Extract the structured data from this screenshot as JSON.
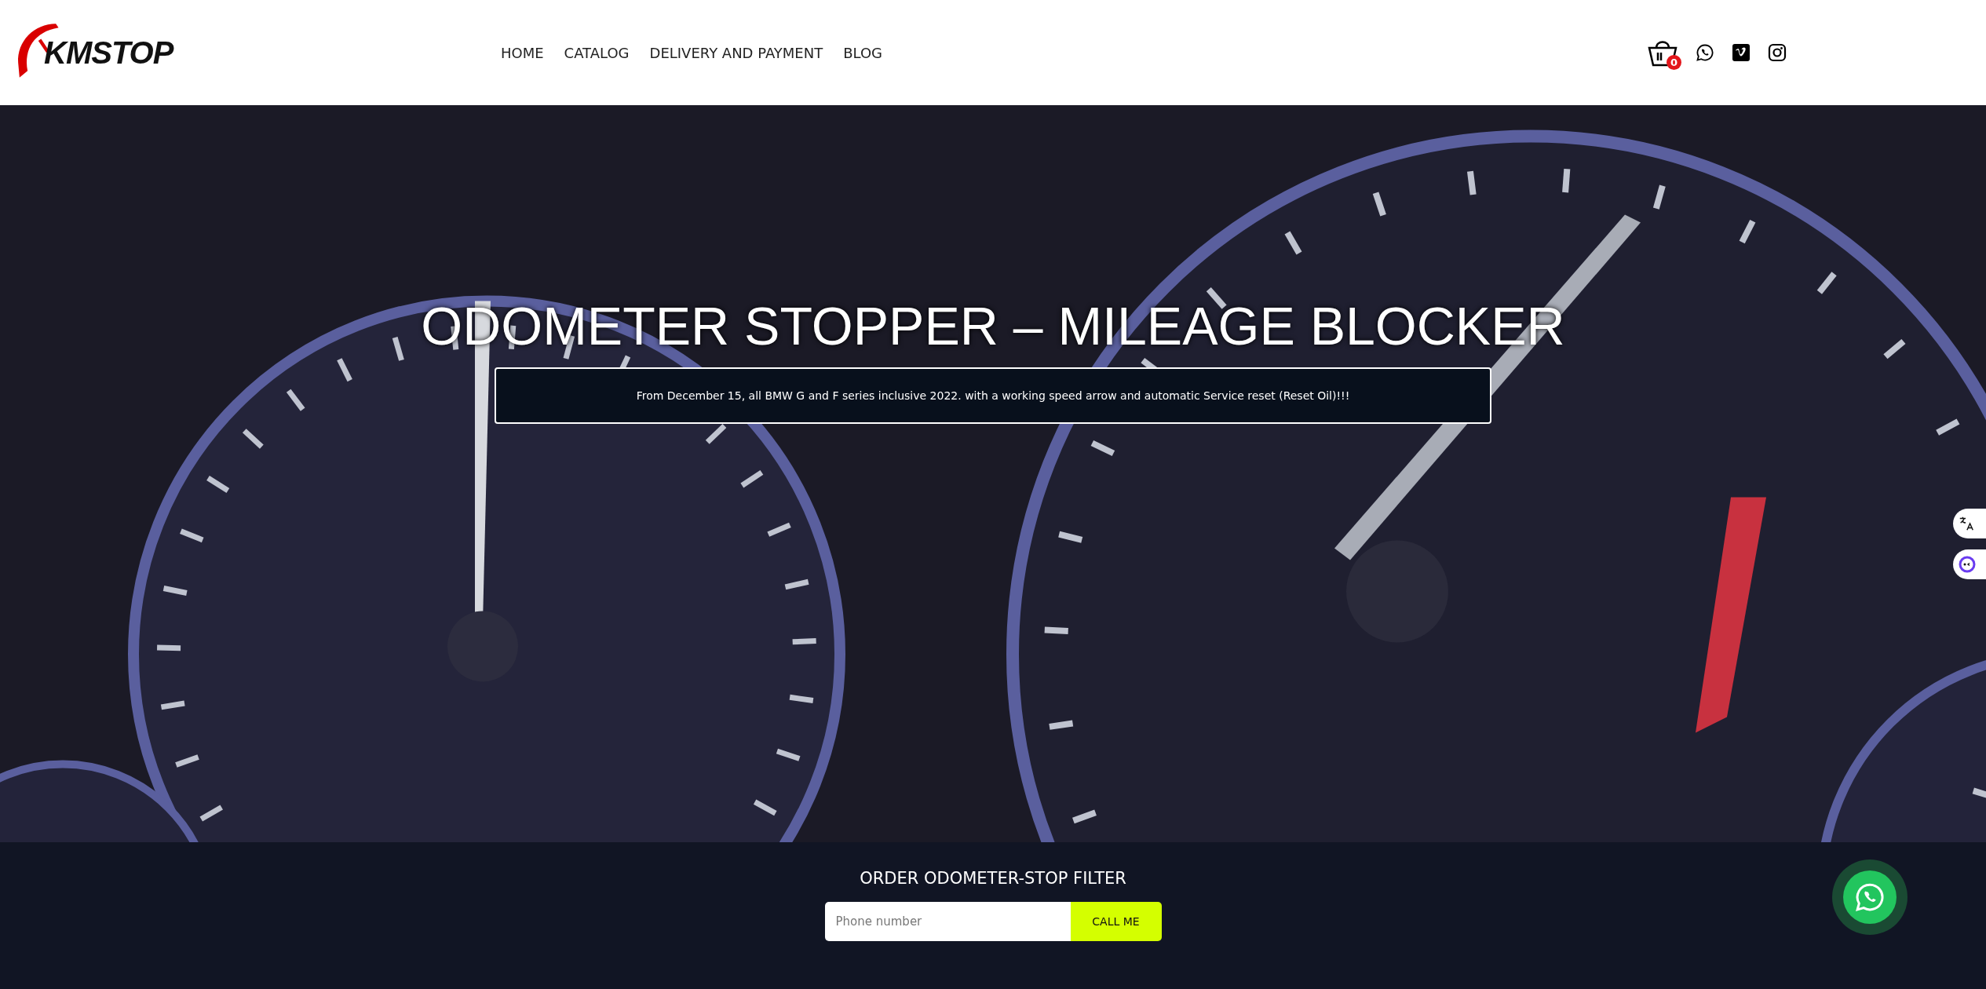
{
  "logo": {
    "text": "KMSTOP"
  },
  "nav": [
    {
      "label": "HOME"
    },
    {
      "label": "CATALOG"
    },
    {
      "label": "DELIVERY AND PAYMENT"
    },
    {
      "label": "BLOG"
    }
  ],
  "cart": {
    "count": "0"
  },
  "hero": {
    "kind": "picture",
    "title": "ODOMETER STOPPER – MILEAGE BLOCKER",
    "subtitle": "From December 15, all BMW G and F series inclusive 2022. with a working speed arrow and automatic Service reset (Reset Oil)!!!"
  },
  "order": {
    "title": "ORDER ODOMETER-STOP FILTER",
    "placeholder": "Phone number",
    "button": "CALL ME"
  }
}
